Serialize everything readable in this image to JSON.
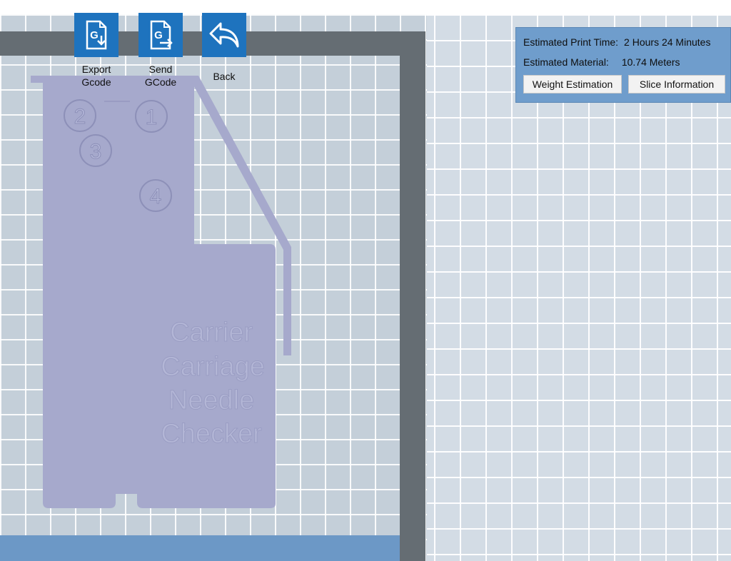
{
  "toolbar": {
    "export_label": "Export\nGcode",
    "send_label": "Send\nGCode",
    "back_label": "Back",
    "export_icon": "export-gcode-icon",
    "send_icon": "send-gcode-icon",
    "back_icon": "back-arrow-icon",
    "accent": "#1e73be"
  },
  "info": {
    "time_label": "Estimated Print Time:",
    "time_value": "2 Hours 24 Minutes",
    "material_label": "Estimated Material:",
    "material_value": "10.74 Meters",
    "weight_button": "Weight Estimation",
    "slice_button": "Slice Information",
    "panel_color": "#6f9dcc"
  },
  "model": {
    "hole_labels": [
      "2",
      "1",
      "3",
      "4"
    ],
    "embossed_text": [
      "Carrier",
      "Carriage",
      "Needle",
      "Checker"
    ],
    "color": "#a6a9cc"
  },
  "bed": {
    "grid_color": "#c4cfd9",
    "edge_color": "#656d73",
    "bottom_color": "#6c98c6"
  }
}
